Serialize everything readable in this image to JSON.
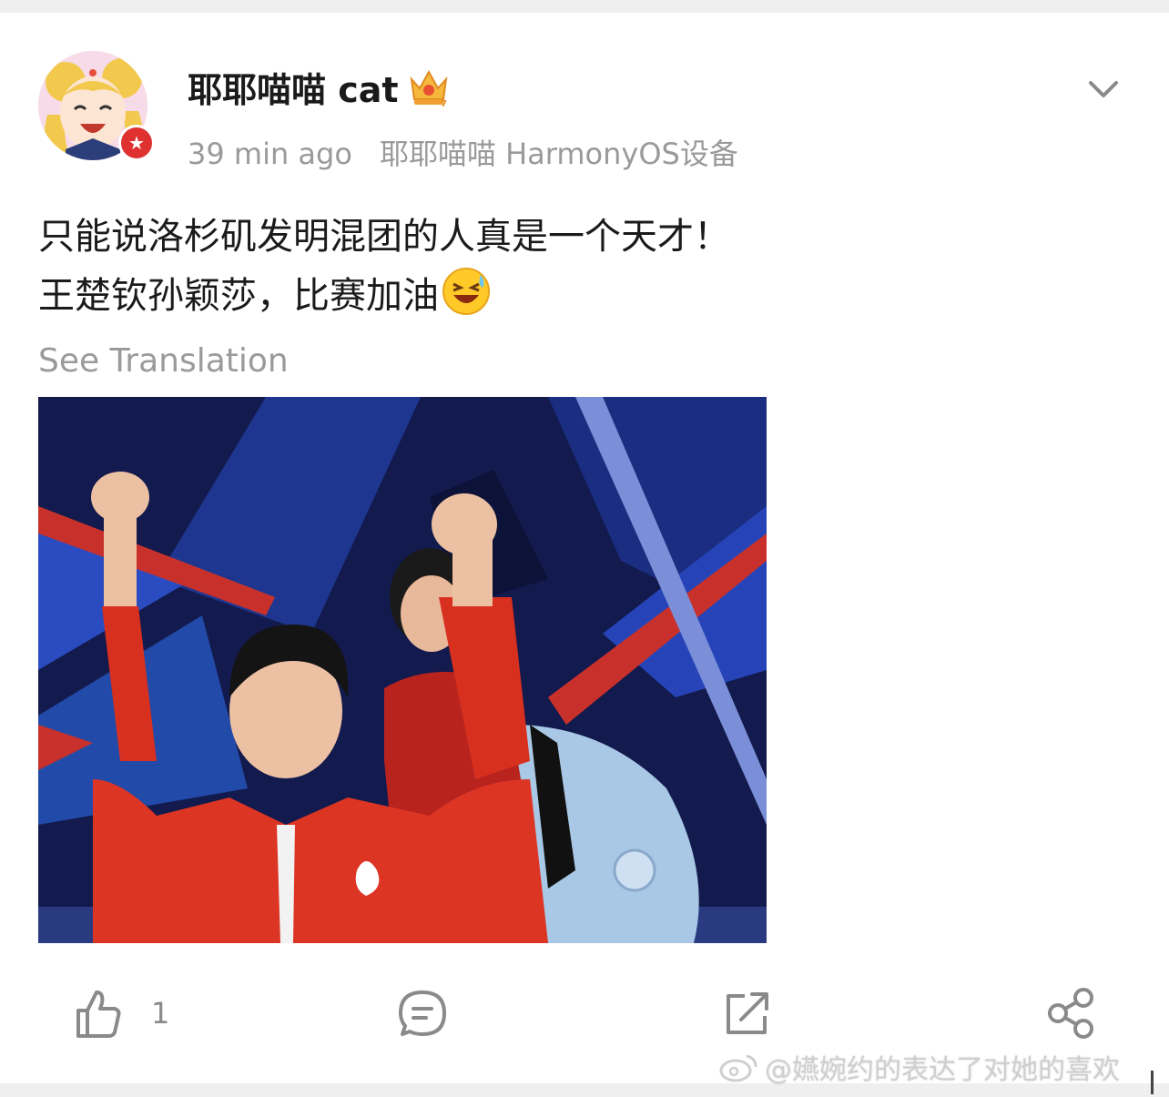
{
  "post": {
    "author": {
      "name": "耶耶喵喵 cat",
      "avatar_icon": "sailor-moon-avatar-icon",
      "badge_icon": "verified-star-badge-icon",
      "member_icon": "crown-icon"
    },
    "time": "39 min ago",
    "device": "耶耶喵喵 HarmonyOS设备",
    "text_line1": "只能说洛杉矶发明混团的人真是一个天才！",
    "text_line2": "王楚钦孙颖莎，比赛加油",
    "emoji_icon": "laugh-cry-emoji-icon",
    "see_translation": "See Translation",
    "image_icon": "photo-two-athletes-raising-fists"
  },
  "actions": {
    "like_count": "1",
    "like_icon": "thumbs-up-icon",
    "comment_icon": "comment-icon",
    "repost_icon": "repost-icon",
    "share_icon": "share-icon"
  },
  "watermark": {
    "text": "@嬿婉约的表达了对她的喜欢",
    "icon": "weibo-logo-icon"
  },
  "colors": {
    "text_primary": "#1a1a1a",
    "text_secondary": "#9a9a9a",
    "badge_red": "#e03131",
    "icon_gray": "#8a8a8a"
  }
}
